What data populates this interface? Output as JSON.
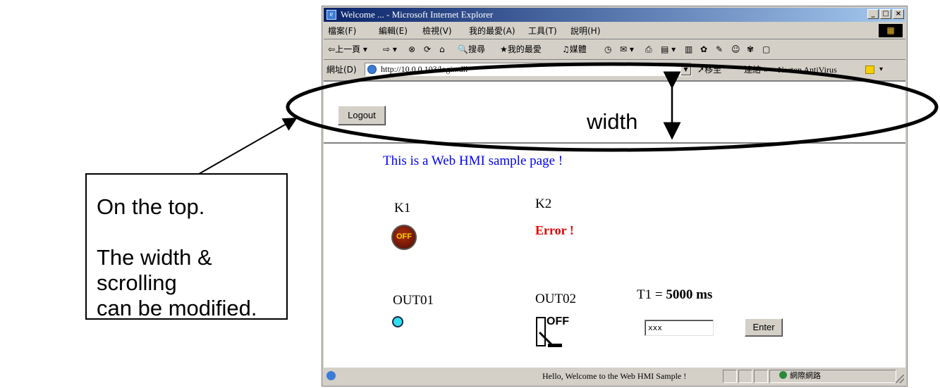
{
  "callout": {
    "line1": "On the top.",
    "line2": "The width & scrolling",
    "line3": "can be modified."
  },
  "annotation": {
    "width_label": "width"
  },
  "browser": {
    "title": "Welcome ... - Microsoft Internet Explorer",
    "menu": [
      "檔案(F)",
      "編輯(E)",
      "檢視(V)",
      "我的最愛(A)",
      "工具(T)",
      "說明(H)"
    ],
    "toolbar": {
      "back": "上一頁",
      "search": "搜尋",
      "favorites": "我的最愛",
      "media": "媒體"
    },
    "address_label": "網址(D)",
    "url": "http://10.0.0.103/login.dll",
    "go": "移至",
    "links": "連結 »",
    "norton": "Norton AntiVirus",
    "status_message": "Hello, Welcome to the Web HMI Sample !",
    "status_zone": "網際網路"
  },
  "top_frame": {
    "logout_label": "Logout"
  },
  "main_frame": {
    "heading": "This is a Web HMI sample page !",
    "k1_label": "K1",
    "k1_state": "OFF",
    "k2_label": "K2",
    "k2_status": "Error !",
    "out01_label": "OUT01",
    "out02_label": "OUT02",
    "out02_state": "OFF",
    "t1_label": "T1 = ",
    "t1_value": "5000 ms",
    "input_value": "xxx",
    "enter_label": "Enter"
  },
  "colors": {
    "heading": "#0000ff",
    "error": "#e00000",
    "led": "#30e0f0"
  }
}
